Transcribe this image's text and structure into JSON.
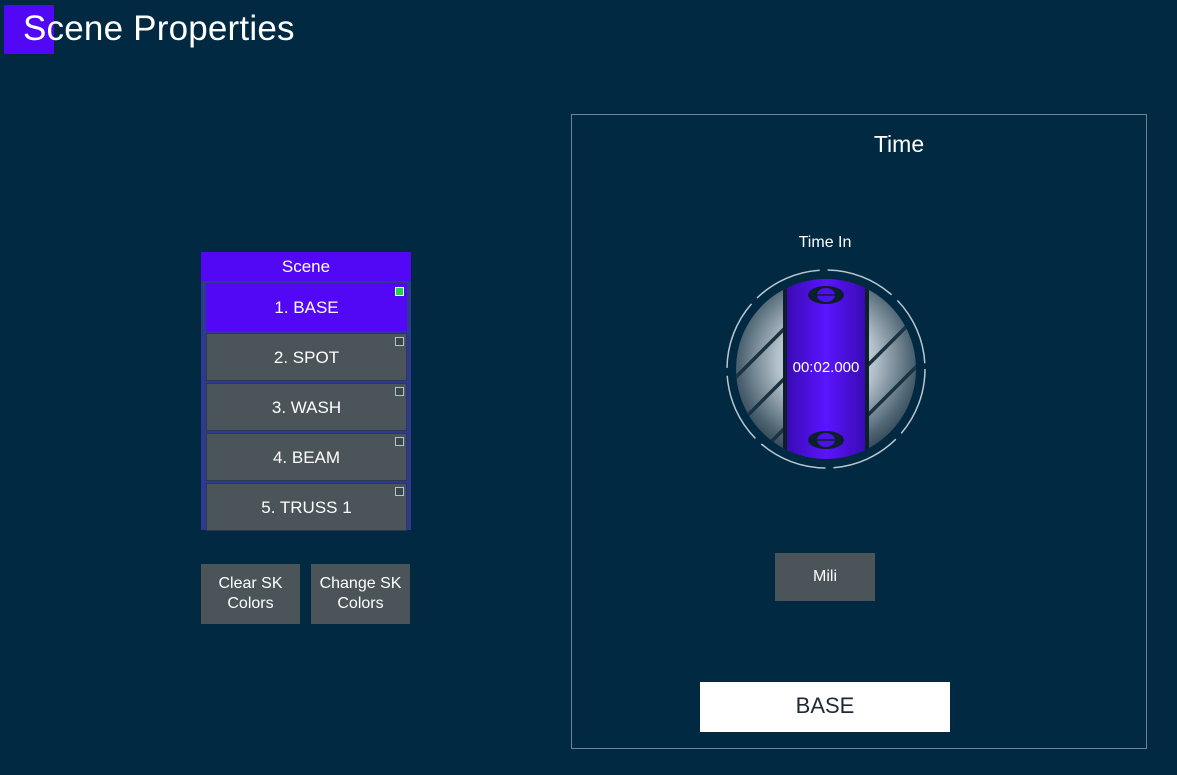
{
  "page": {
    "title": "Scene Properties"
  },
  "scene_list": {
    "header": "Scene",
    "selected_index": 0,
    "items": [
      {
        "label": "1. BASE",
        "active": true
      },
      {
        "label": "2. SPOT",
        "active": false
      },
      {
        "label": "3. WASH",
        "active": false
      },
      {
        "label": "4. BEAM",
        "active": false
      },
      {
        "label": "5. TRUSS 1",
        "active": false
      }
    ]
  },
  "buttons": {
    "clear_sk_colors": "Clear SK Colors",
    "change_sk_colors": "Change SK Colors"
  },
  "time_panel": {
    "title": "Time",
    "time_in_label": "Time In",
    "time_in_value": "00:02.000",
    "unit_button": "Mili",
    "scene_name": "BASE"
  },
  "colors": {
    "background": "#012a42",
    "accent": "#5208f5",
    "button_gray": "#4b5559",
    "indicator_green": "#23d14c"
  },
  "icons": {
    "knob": "rotary-time-knob",
    "indicator": "scene-indicator-square"
  }
}
